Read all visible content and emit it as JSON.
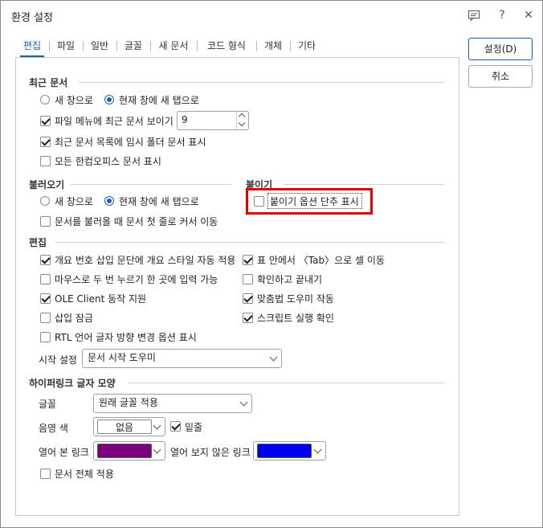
{
  "window": {
    "title": "환경 설정",
    "icons": {
      "help_panel": "help-panel-icon",
      "help": "?",
      "close": "✕"
    }
  },
  "tabs": [
    {
      "label": "편집",
      "active": true
    },
    {
      "label": "파일"
    },
    {
      "label": "일반"
    },
    {
      "label": "글꼴"
    },
    {
      "label": "새 문서"
    },
    {
      "label": "코드 형식"
    },
    {
      "label": "개체"
    },
    {
      "label": "기타"
    }
  ],
  "buttons": {
    "ok": "설정(D)",
    "cancel": "취소"
  },
  "recent": {
    "title": "최근 문서",
    "radio_new_window": "새 창으로",
    "radio_new_tab": "현재 창에 새 탭으로",
    "show_in_file_menu": "파일 메뉴에 최근 문서 보이기",
    "count_value": "9",
    "show_temp_folder": "최근 문서 목록에 임시 폴더 문서 표시",
    "show_all_hancom": "모든 한컴오피스 문서 표시"
  },
  "load": {
    "title": "불러오기",
    "radio_new_window": "새 창으로",
    "radio_new_tab": "현재 창에 새 탭으로",
    "cursor_first_line": "문서를 불러올 때 문서 첫 줄로 커서 이동"
  },
  "paste": {
    "title": "붙이기",
    "show_option_shortcut": "붙이기 옵션 단추 표시"
  },
  "edit": {
    "title": "편집",
    "auto_outline": "개요 번호 삽입 문단에 개요 스타일 자동 적용",
    "double_click_input": "마우스로 두 번 누르기 한 곳에 입력 가능",
    "ole_client": "OLE Client 동작 지원",
    "insert_lock": "삽입 잠금",
    "rtl_option": "RTL 언어 글자 방향 변경 옵션 표시",
    "tab_move_cell": "표 안에서 〈Tab〉으로 셀 이동",
    "confirm_exit": "확인하고 끝내기",
    "spell_helper": "맞춤법 도우미 작동",
    "script_confirm": "스크립트 실행 확인",
    "start_setting_label": "시작 설정",
    "start_setting_value": "문서 시작 도우미"
  },
  "hyperlink": {
    "title": "하이퍼링크 글자 모양",
    "font_label": "글꼴",
    "font_value": "원래 글꼴 적용",
    "shade_label": "음영 색",
    "shade_value": "없음",
    "underline": "밑줄",
    "visited_label": "열어 본 링크",
    "visited_color": "#7b007b",
    "unvisited_label": "열어 보지 않은 링크",
    "unvisited_color": "#0000ee",
    "apply_all": "문서 전체 적용"
  },
  "accent_color": "#1a5fc0",
  "highlight_color": "#e00000"
}
